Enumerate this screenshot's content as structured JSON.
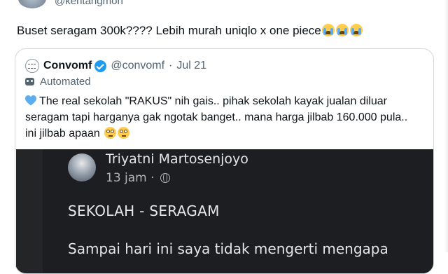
{
  "author": {
    "handle": "@kentangmon"
  },
  "tweet": {
    "text": "Buset seragam 300k???? Lebih murah uniqlo x one piece"
  },
  "quoted": {
    "name": "Convomf",
    "handle": "@convomf",
    "separator": "·",
    "date": "Jul 21",
    "label": "Automated",
    "lines": [
      "The real sekolah \"RAKUS\" nih gais.. pihak sekolah kayak jualan diluar",
      "seragam tapi harganya gak ngotak banget.. mana harga jilbab 160.000 pula..",
      "ini jilbab apaan"
    ]
  },
  "fb_post": {
    "name": "Triyatni Martosenjoyo",
    "time": "13 jam ·",
    "heading": "SEKOLAH - SERAGAM",
    "body": "Sampai hari ini saya tidak mengerti mengapa"
  },
  "colors": {
    "verified": "#1d9bf0",
    "heart": "#5dadec",
    "secondary_text": "#536471",
    "fb_background": "#242526"
  },
  "icons": [
    "verified-badge-icon",
    "robot-icon",
    "blue-heart-icon",
    "eye-roll-emoji-icon",
    "loudly-crying-emoji-icon",
    "globe-icon"
  ]
}
